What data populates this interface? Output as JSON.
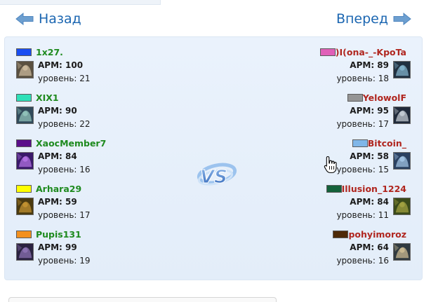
{
  "nav": {
    "prev_label": "Назад",
    "next_label": "Вперед",
    "prev_icon": "arrow-left-icon",
    "next_icon": "arrow-right-icon",
    "link_color": "#1b66b1"
  },
  "vs_label": "VS",
  "colors": {
    "left_name": "#1e8a1e",
    "right_name": "#b0261f",
    "panel_bg": "#e7f0fb"
  },
  "left_team": [
    {
      "name": "1x27.",
      "color": "#1a4ef2",
      "apm_label": "APM: 100",
      "level_label": "уровень: 21",
      "avatar": [
        "#5a5040",
        "#c9b79a"
      ]
    },
    {
      "name": "XIX1",
      "color": "#2ee0b8",
      "apm_label": "APM: 90",
      "level_label": "уровень: 22",
      "avatar": [
        "#314a5a",
        "#8fc0b8"
      ]
    },
    {
      "name": "XaocMember7",
      "color": "#5a0f8a",
      "apm_label": "APM: 84",
      "level_label": "уровень: 16",
      "avatar": [
        "#3a1a6a",
        "#b070e0"
      ]
    },
    {
      "name": "Arhara29",
      "color": "#ffff00",
      "apm_label": "APM: 59",
      "level_label": "уровень: 17",
      "avatar": [
        "#4a3a10",
        "#c09030"
      ]
    },
    {
      "name": "Pupis131",
      "color": "#f3901e",
      "apm_label": "APM: 99",
      "level_label": "уровень: 19",
      "avatar": [
        "#2a2240",
        "#8a70b0"
      ]
    }
  ],
  "right_team": [
    {
      "name": ")I(ona-_-KpoTa",
      "color": "#e060b8",
      "apm_label": "APM: 89",
      "level_label": "уровень: 18",
      "avatar": [
        "#203040",
        "#80b0c8"
      ]
    },
    {
      "name": "YelowolF",
      "color": "#959595",
      "apm_label": "APM: 95",
      "level_label": "уровень: 17",
      "avatar": [
        "#202a3a",
        "#c0c8d0"
      ]
    },
    {
      "name": "Bitcoin_",
      "color": "#7fb6e8",
      "apm_label": "APM: 58",
      "level_label": "уровень: 15",
      "avatar": [
        "#2a4060",
        "#9fc0e0"
      ]
    },
    {
      "name": "Illusion_1224",
      "color": "#14613a",
      "apm_label": "APM: 84",
      "level_label": "уровень: 11",
      "avatar": [
        "#3a4a1a",
        "#a0a040"
      ]
    },
    {
      "name": "pohyimoroz",
      "color": "#4e2a08",
      "apm_label": "APM: 64",
      "level_label": "уровень: 16",
      "avatar": [
        "#303a40",
        "#c8b890"
      ]
    }
  ]
}
